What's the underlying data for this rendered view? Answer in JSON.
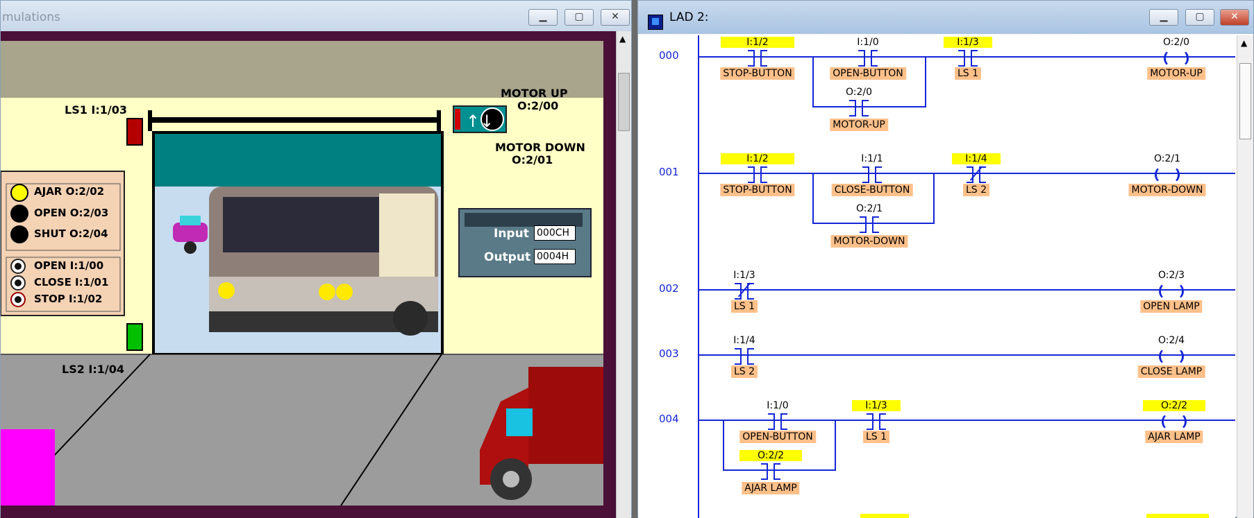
{
  "sim": {
    "title": "mulations",
    "scene": {
      "motor_up": "MOTOR UP",
      "motor_up_addr": "O:2/00",
      "motor_down": "MOTOR DOWN",
      "motor_down_addr": "O:2/01",
      "ls1": "LS1  I:1/03",
      "ls2": "LS2  I:1/04",
      "panel": {
        "lamps": [
          {
            "label": "AJAR O:2/02",
            "color": "#ffff00"
          },
          {
            "label": "OPEN  O:2/03",
            "color": "#000000"
          },
          {
            "label": "SHUT  O:2/04",
            "color": "#000000"
          }
        ],
        "buttons": [
          {
            "label": "OPEN   I:1/00"
          },
          {
            "label": "CLOSE I:1/01"
          },
          {
            "label": "STOP   I:1/02"
          }
        ]
      },
      "plc": {
        "input_label": "Input",
        "input_value": "000CH",
        "output_label": "Output",
        "output_value": "0004H"
      }
    }
  },
  "lad": {
    "title": "LAD 2:",
    "rungs": [
      {
        "no": "000"
      },
      {
        "no": "001"
      },
      {
        "no": "002"
      },
      {
        "no": "003"
      },
      {
        "no": "004"
      }
    ],
    "r0": {
      "a_addr": "I:1/2",
      "a_lbl": "STOP-BUTTON",
      "b_addr": "I:1/0",
      "b_lbl": "OPEN-BUTTON",
      "c_addr": "O:2/0",
      "c_lbl": "MOTOR-UP",
      "d_addr": "I:1/3",
      "d_lbl": "LS 1",
      "coil_addr": "O:2/0",
      "coil_lbl": "MOTOR-UP"
    },
    "r1": {
      "a_addr": "I:1/2",
      "a_lbl": "STOP-BUTTON",
      "b_addr": "I:1/1",
      "b_lbl": "CLOSE-BUTTON",
      "c_addr": "O:2/1",
      "c_lbl": "MOTOR-DOWN",
      "d_addr": "I:1/4",
      "d_lbl": "LS 2",
      "coil_addr": "O:2/1",
      "coil_lbl": "MOTOR-DOWN"
    },
    "r2": {
      "a_addr": "I:1/3",
      "a_lbl": "LS 1",
      "coil_addr": "O:2/3",
      "coil_lbl": "OPEN LAMP"
    },
    "r3": {
      "a_addr": "I:1/4",
      "a_lbl": "LS 2",
      "coil_addr": "O:2/4",
      "coil_lbl": "CLOSE LAMP"
    },
    "r4": {
      "a_addr": "I:1/0",
      "a_lbl": "OPEN-BUTTON",
      "b_addr": "O:2/2",
      "b_lbl": "AJAR LAMP",
      "c_addr": "I:1/3",
      "c_lbl": "LS 1",
      "coil_addr": "O:2/2",
      "coil_lbl": "AJAR LAMP"
    }
  }
}
